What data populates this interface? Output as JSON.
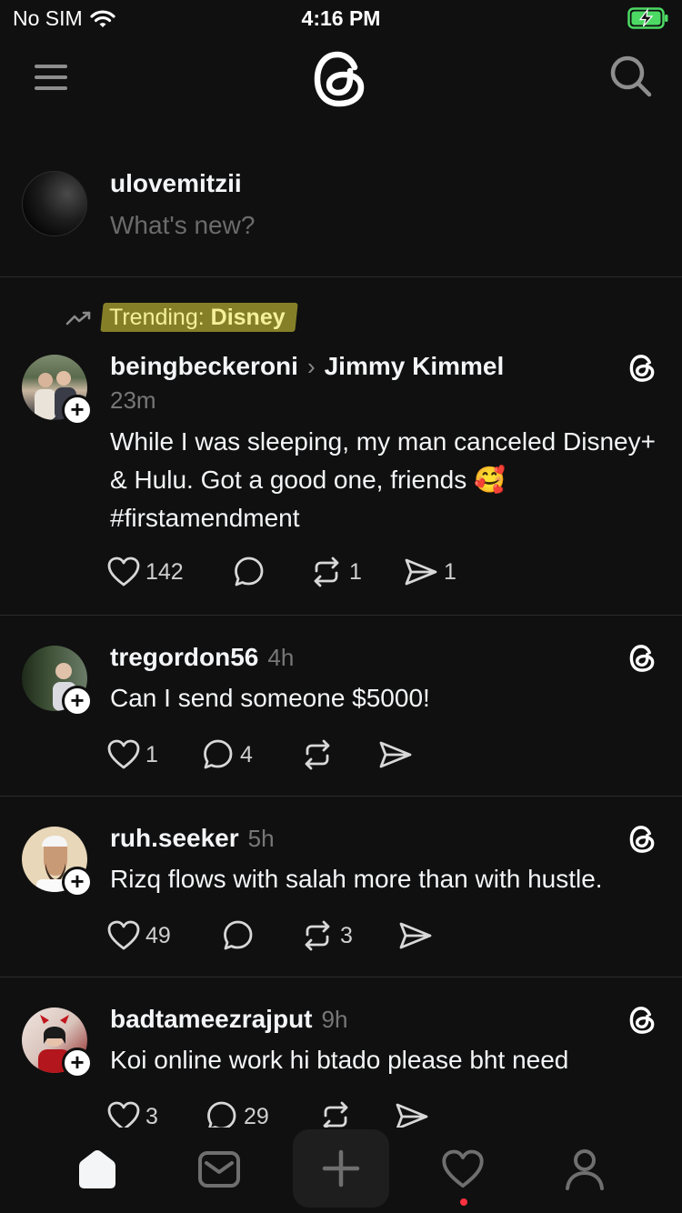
{
  "status_bar": {
    "carrier": "No SIM",
    "time": "4:16 PM"
  },
  "composer": {
    "username": "ulovemitzii",
    "placeholder": "What's new?"
  },
  "posts": [
    {
      "trending_prefix": "Trending: ",
      "trending_topic": "Disney",
      "username": "beingbeckeroni",
      "reply_to": "Jimmy Kimmel",
      "time": "23m",
      "text": "While I was sleeping, my man canceled Disney+ & Hulu. Got a good one, friends 🥰 #firstamendment",
      "likes": "142",
      "replies": "",
      "reposts": "1",
      "shares": "1"
    },
    {
      "username": "tregordon56",
      "time": "4h",
      "text": "Can I send someone $5000!",
      "likes": "1",
      "replies": "4",
      "reposts": "",
      "shares": ""
    },
    {
      "username": "ruh.seeker",
      "time": "5h",
      "text": "Rizq flows with salah more than with hustle.",
      "likes": "49",
      "replies": "",
      "reposts": "3",
      "shares": ""
    },
    {
      "username": "badtameezrajput",
      "time": "9h",
      "text": "Koi online work hi btado please bht need",
      "likes": "3",
      "replies": "29",
      "reposts": "",
      "shares": ""
    }
  ],
  "icons": {
    "menu": "menu-icon",
    "logo": "threads-logo-icon",
    "search": "search-icon",
    "like": "heart-icon",
    "reply": "comment-icon",
    "repost": "repost-icon",
    "share": "send-icon",
    "tabs": [
      "home-icon",
      "inbox-icon",
      "plus-icon",
      "heart-icon",
      "profile-icon"
    ]
  },
  "colors": {
    "background": "#101010",
    "trending_highlight": "#e6dc3c",
    "notification_dot": "#ff3040"
  }
}
